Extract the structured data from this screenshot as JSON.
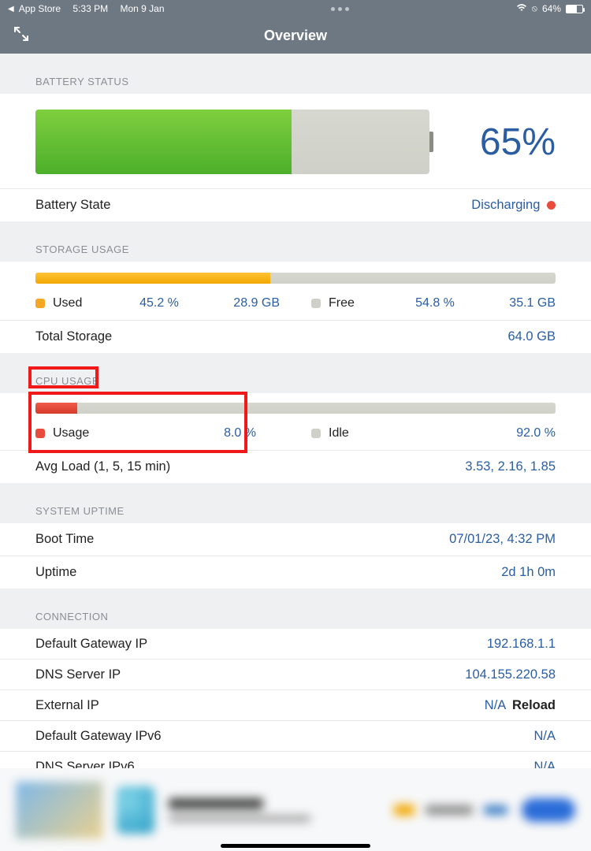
{
  "statusbar": {
    "back_app": "App Store",
    "time": "5:33 PM",
    "date": "Mon 9 Jan",
    "battery_pct": "64%"
  },
  "header": {
    "title": "Overview"
  },
  "battery": {
    "section": "BATTERY STATUS",
    "pct_text": "65%",
    "state_label": "Battery State",
    "state_value": "Discharging"
  },
  "storage": {
    "section": "STORAGE USAGE",
    "used_label": "Used",
    "used_pct": "45.2 %",
    "used_gb": "28.9 GB",
    "free_label": "Free",
    "free_pct": "54.8 %",
    "free_gb": "35.1 GB",
    "total_label": "Total Storage",
    "total_gb": "64.0 GB"
  },
  "cpu": {
    "section": "CPU USAGE",
    "usage_label": "Usage",
    "usage_pct": "8.0 %",
    "idle_label": "Idle",
    "idle_pct": "92.0 %",
    "avg_label": "Avg Load (1, 5, 15 min)",
    "avg_value": "3.53, 2.16, 1.85"
  },
  "uptime": {
    "section": "SYSTEM UPTIME",
    "boot_label": "Boot Time",
    "boot_value": "07/01/23, 4:32 PM",
    "uptime_label": "Uptime",
    "uptime_value": "2d 1h 0m"
  },
  "connection": {
    "section": "CONNECTION",
    "rows": [
      {
        "label": "Default Gateway IP",
        "value": "192.168.1.1"
      },
      {
        "label": "DNS Server IP",
        "value": "104.155.220.58"
      },
      {
        "label": "External IP",
        "value": "N/A",
        "reload": "Reload"
      },
      {
        "label": "Default Gateway IPv6",
        "value": "N/A"
      },
      {
        "label": "DNS Server IPv6",
        "value": "N/A"
      }
    ]
  }
}
